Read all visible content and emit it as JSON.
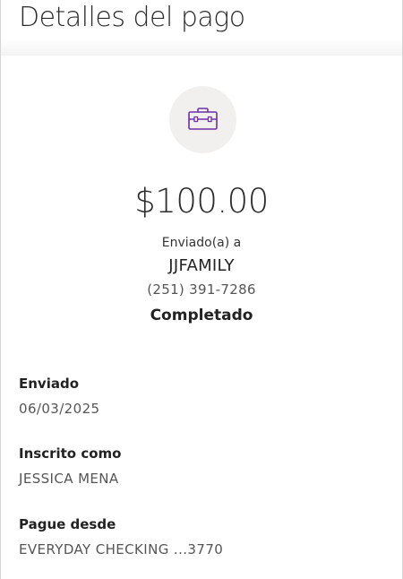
{
  "header": {
    "title": "Detalles del pago"
  },
  "summary": {
    "icon": "briefcase-icon",
    "icon_color": "#6b2fa6",
    "amount": "$100.00",
    "sent_to_label": "Enviado(a) a",
    "recipient_name": "JJFAMILY",
    "recipient_phone": "(251) 391-7286",
    "status": "Completado"
  },
  "details": {
    "sent": {
      "label": "Enviado",
      "value": "06/03/2025"
    },
    "enrolled_as": {
      "label": "Inscrito como",
      "value": "JESSICA MENA"
    },
    "pay_from": {
      "label": "Pague desde",
      "value": "EVERYDAY CHECKING ...3770"
    }
  }
}
